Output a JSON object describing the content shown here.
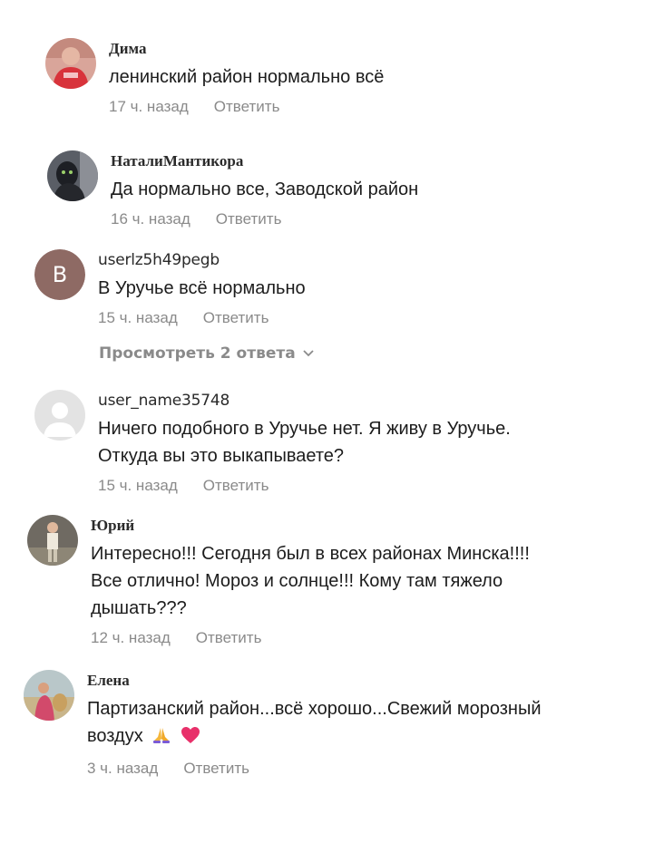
{
  "comments": [
    {
      "username": "Дима",
      "text": "ленинский район нормально всё",
      "time": "17 ч. назад",
      "reply": "Ответить",
      "avatar": "photo-avatar"
    },
    {
      "username": "НаталиМантикора",
      "text": "Да нормально все, Заводской район",
      "time": "16 ч. назад",
      "reply": "Ответить",
      "avatar": "photo-avatar"
    },
    {
      "username": "userlz5h49pegb",
      "text": "В Уручье всё нормально",
      "time": "15 ч. назад",
      "reply": "Ответить",
      "avatar_letter": "B",
      "avatar_color": "#8e6a64"
    },
    {
      "username": "user_name35748",
      "text": "Ничего подобного в Уручье нет. Я живу в Уручье. Откуда вы это выкапываете?",
      "time": "15 ч. назад",
      "reply": "Ответить",
      "avatar": "default-user-icon"
    },
    {
      "username": "Юрий",
      "text": "Интересно!!! Сегодня был в всех районах Минска!!!! Все отлично! Мороз и солнце!!! Кому там тяжело дышать???",
      "time": "12 ч. назад",
      "reply": "Ответить",
      "avatar": "photo-avatar"
    },
    {
      "username": "Елена",
      "text": "Партизанский район...всё хорошо...Свежий морозный воздух",
      "time": "3 ч. назад",
      "reply": "Ответить",
      "avatar": "photo-avatar",
      "emojis": [
        "folded-hands-icon",
        "heart-icon"
      ]
    }
  ],
  "view_replies": {
    "label": "Просмотреть 2 ответа",
    "icon": "chevron-down-icon"
  },
  "colors": {
    "meta_text": "#8a8a8a",
    "letter_avatar_bg": "#8e6a64",
    "heart": "#e8306a"
  }
}
